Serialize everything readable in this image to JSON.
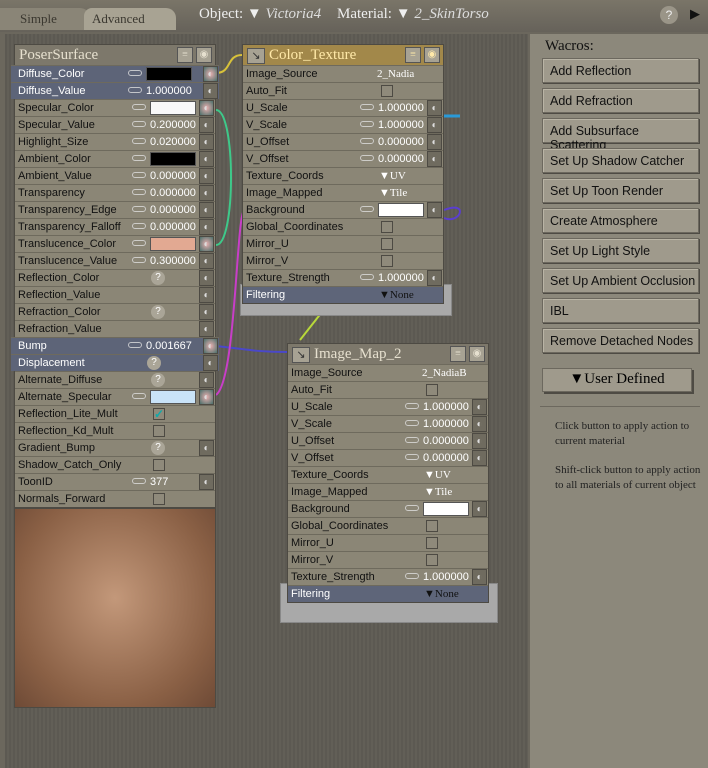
{
  "tabs": {
    "simple": "Simple",
    "advanced": "Advanced"
  },
  "header": {
    "object_label": "Object:",
    "object_value": "Victoria4",
    "material_label": "Material:",
    "material_value": "2_SkinTorso",
    "help": "?"
  },
  "wacros": {
    "title": "Wacros:",
    "buttons": [
      "Add Reflection",
      "Add Refraction",
      "Add Subsurface Scattering",
      "Set Up Shadow Catcher",
      "Set Up Toon Render",
      "Create Atmosphere",
      "Set Up Light Style",
      "Set Up Ambient Occlusion",
      "IBL",
      "Remove Detached Nodes"
    ],
    "user_defined": "User Defined",
    "help1": "Click button to apply action to current material",
    "help2": "Shift-click button to apply action to all materials of current object"
  },
  "nodes": [
    {
      "id": "poser",
      "title": "PoserSurface",
      "rows": [
        {
          "label": "Diffuse_Color",
          "kind": "color",
          "color": "#000000",
          "sel": true,
          "plugIn": true
        },
        {
          "label": "Diffuse_Value",
          "kind": "value",
          "value": "1.000000",
          "sel": true
        },
        {
          "label": "Specular_Color",
          "kind": "color",
          "color": "#f8f8f8",
          "plugIn": true
        },
        {
          "label": "Specular_Value",
          "kind": "value",
          "value": "0.200000"
        },
        {
          "label": "Highlight_Size",
          "kind": "value",
          "value": "0.020000"
        },
        {
          "label": "Ambient_Color",
          "kind": "color",
          "color": "#000000"
        },
        {
          "label": "Ambient_Value",
          "kind": "value",
          "value": "0.000000"
        },
        {
          "label": "Transparency",
          "kind": "value",
          "value": "0.000000"
        },
        {
          "label": "Transparency_Edge",
          "kind": "value",
          "value": "0.000000"
        },
        {
          "label": "Transparency_Falloff",
          "kind": "value",
          "value": "0.000000"
        },
        {
          "label": "Translucence_Color",
          "kind": "color",
          "color": "#e2a992",
          "plugIn": true
        },
        {
          "label": "Translucence_Value",
          "kind": "value",
          "value": "0.300000"
        },
        {
          "label": "Reflection_Color",
          "kind": "question"
        },
        {
          "label": "Reflection_Value",
          "kind": "blank"
        },
        {
          "label": "Refraction_Color",
          "kind": "question"
        },
        {
          "label": "Refraction_Value",
          "kind": "blank"
        },
        {
          "label": "Bump",
          "kind": "value",
          "value": "0.001667",
          "sel": true,
          "plugIn": true
        },
        {
          "label": "Displacement",
          "kind": "question",
          "sel": true
        },
        {
          "label": "Alternate_Diffuse",
          "kind": "question"
        },
        {
          "label": "Alternate_Specular",
          "kind": "color",
          "color": "#c9e3f8",
          "plugIn": true
        },
        {
          "label": "Reflection_Lite_Mult",
          "kind": "checkbox",
          "checked": true
        },
        {
          "label": "Reflection_Kd_Mult",
          "kind": "checkbox"
        },
        {
          "label": "Gradient_Bump",
          "kind": "question"
        },
        {
          "label": "Shadow_Catch_Only",
          "kind": "checkbox"
        },
        {
          "label": "ToonID",
          "kind": "value",
          "value": "377"
        },
        {
          "label": "Normals_Forward",
          "kind": "checkbox"
        }
      ]
    },
    {
      "id": "ct",
      "title": "Color_Texture",
      "rows": [
        {
          "label": "Image_Source",
          "kind": "text",
          "value": "2_Nadia"
        },
        {
          "label": "Auto_Fit",
          "kind": "checkbox"
        },
        {
          "label": "U_Scale",
          "kind": "value",
          "value": "1.000000"
        },
        {
          "label": "V_Scale",
          "kind": "value",
          "value": "1.000000"
        },
        {
          "label": "U_Offset",
          "kind": "value",
          "value": "0.000000"
        },
        {
          "label": "V_Offset",
          "kind": "value",
          "value": "0.000000"
        },
        {
          "label": "Texture_Coords",
          "kind": "dropdown",
          "value": "UV"
        },
        {
          "label": "Image_Mapped",
          "kind": "dropdown",
          "value": "Tile"
        },
        {
          "label": "Background",
          "kind": "color",
          "color": "#ffffff"
        },
        {
          "label": "Global_Coordinates",
          "kind": "checkbox"
        },
        {
          "label": "Mirror_U",
          "kind": "checkbox"
        },
        {
          "label": "Mirror_V",
          "kind": "checkbox"
        },
        {
          "label": "Texture_Strength",
          "kind": "value",
          "value": "1.000000"
        },
        {
          "label": "Filtering",
          "kind": "filter",
          "value": "None"
        }
      ]
    },
    {
      "id": "im",
      "title": "Image_Map_2",
      "rows": [
        {
          "label": "Image_Source",
          "kind": "text",
          "value": "2_NadiaB"
        },
        {
          "label": "Auto_Fit",
          "kind": "checkbox"
        },
        {
          "label": "U_Scale",
          "kind": "value",
          "value": "1.000000"
        },
        {
          "label": "V_Scale",
          "kind": "value",
          "value": "1.000000"
        },
        {
          "label": "U_Offset",
          "kind": "value",
          "value": "0.000000"
        },
        {
          "label": "V_Offset",
          "kind": "value",
          "value": "0.000000"
        },
        {
          "label": "Texture_Coords",
          "kind": "dropdown",
          "value": "UV"
        },
        {
          "label": "Image_Mapped",
          "kind": "dropdown",
          "value": "Tile"
        },
        {
          "label": "Background",
          "kind": "color",
          "color": "#ffffff"
        },
        {
          "label": "Global_Coordinates",
          "kind": "checkbox"
        },
        {
          "label": "Mirror_U",
          "kind": "checkbox"
        },
        {
          "label": "Mirror_V",
          "kind": "checkbox"
        },
        {
          "label": "Texture_Strength",
          "kind": "value",
          "value": "1.000000"
        },
        {
          "label": "Filtering",
          "kind": "filter",
          "value": "None"
        }
      ]
    }
  ]
}
